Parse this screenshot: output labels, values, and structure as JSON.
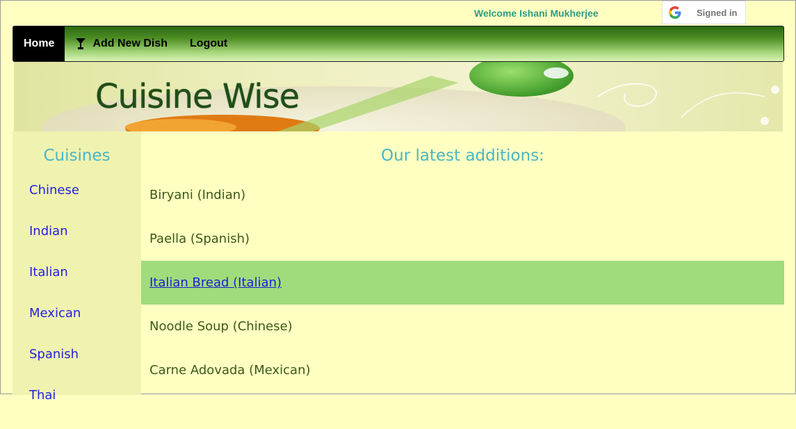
{
  "header": {
    "welcome": "Welcome Ishani Mukherjee",
    "google_signin_label": "Signed in"
  },
  "nav": {
    "items": [
      {
        "label": "Home",
        "active": true
      },
      {
        "label": "Add New Dish",
        "icon": "cocktail-glass-icon"
      },
      {
        "label": "Logout"
      }
    ]
  },
  "banner": {
    "title": "Cuisine Wise"
  },
  "sidebar": {
    "title": "Cuisines",
    "items": [
      "Chinese",
      "Indian",
      "Italian",
      "Mexican",
      "Spanish",
      "Thai"
    ]
  },
  "main": {
    "title": "Our latest additions:",
    "dishes": [
      {
        "label": "Biryani (Indian)"
      },
      {
        "label": "Paella (Spanish)"
      },
      {
        "label": "Italian Bread (Italian)",
        "highlighted": true
      },
      {
        "label": "Noodle Soup (Chinese)"
      },
      {
        "label": "Carne Adovada (Mexican)"
      }
    ]
  },
  "colors": {
    "page_bg": "#ffffc2",
    "accent_title": "#4bb6c4",
    "link": "#2222e0",
    "highlight_row": "#a0dc7c",
    "welcome_text": "#2f9a84"
  }
}
